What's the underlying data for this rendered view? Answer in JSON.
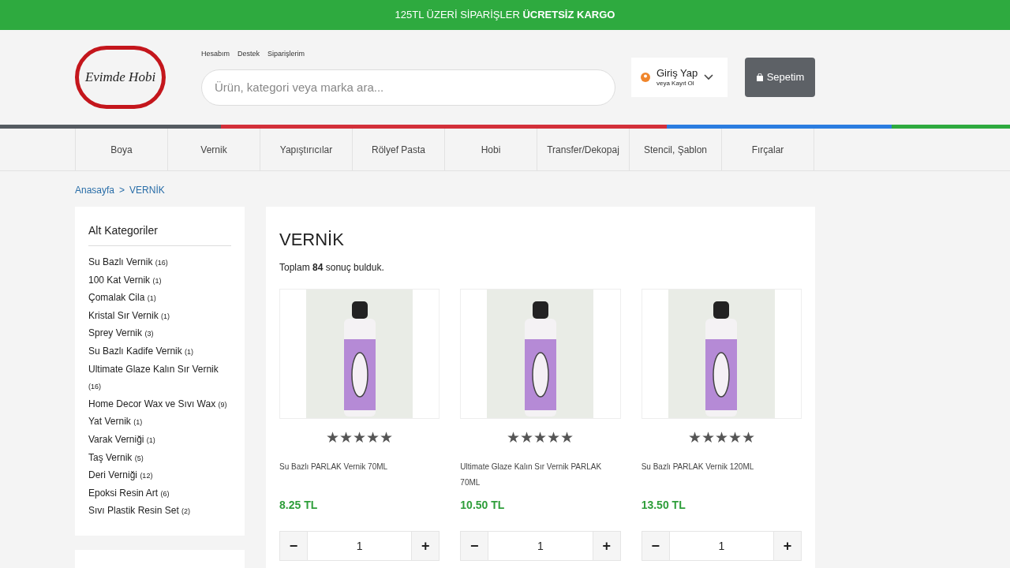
{
  "banner": {
    "text": "125TL ÜZERİ SİPARİŞLER **ÜCRETSİZ KARGO**"
  },
  "header": {
    "logo": "Evimde Hobi",
    "top_links": [
      "Hesabım",
      "Destek",
      "Siparişlerim"
    ],
    "search": {
      "placeholder": "Ürün, kategori veya marka ara..."
    },
    "login": {
      "title": "Giriş Yap",
      "subtitle": "veya Kayıt Ol"
    },
    "cart_button": "Sepetim"
  },
  "nav": [
    {
      "label": "Boya",
      "selected": false
    },
    {
      "label": "Vernik",
      "selected": false
    },
    {
      "label": "Yapıştırıcılar",
      "selected": false
    },
    {
      "label": "Rölyef Pasta",
      "selected": false
    },
    {
      "label": "Hobi",
      "selected": false
    },
    {
      "label": "Transfer/Dekopaj",
      "selected": false
    },
    {
      "label": "Stencil, Şablon",
      "selected": false
    },
    {
      "label": "Fırçalar",
      "selected": false
    }
  ],
  "breadcrumb": [
    "Anasayfa",
    ">",
    "VERNİK"
  ],
  "sidebar": {
    "title": "Alt Kategoriler",
    "items": [
      {
        "name": "Su Bazlı Vernik",
        "count": "(16)"
      },
      {
        "name": "100 Kat Vernik",
        "count": "(1)"
      },
      {
        "name": "Çomalak Cila",
        "count": "(1)"
      },
      {
        "name": "Kristal Sır Vernik",
        "count": "(1)"
      },
      {
        "name": "Sprey Vernik",
        "count": "(3)"
      },
      {
        "name": "Su Bazlı Kadife Vernik",
        "count": "(1)"
      },
      {
        "name": "Ultimate Glaze Kalın Sır Vernik",
        "count": "(16)"
      },
      {
        "name": "Home Decor Wax ve Sıvı Wax",
        "count": "(9)"
      },
      {
        "name": "Yat Vernik",
        "count": "(1)"
      },
      {
        "name": "Varak Verniği",
        "count": "(1)"
      },
      {
        "name": "Taş Vernik",
        "count": "(5)"
      },
      {
        "name": "Deri Verniği",
        "count": "(12)"
      },
      {
        "name": "Epoksi Resin Art",
        "count": "(6)"
      },
      {
        "name": "Sıvı Plastik Resin Set",
        "count": "(2)"
      }
    ]
  },
  "main": {
    "title": "VERNİK",
    "summary": "Toplam **84** sonuç bulduk.",
    "products": [
      {
        "name": "Su Bazlı PARLAK Vernik 70ML",
        "price": "8.25 TL",
        "stars": 5,
        "quantity": "1"
      },
      {
        "name": "Ultimate Glaze Kalın Sır Vernik PARLAK 70ML",
        "price": "10.50 TL",
        "stars": 5,
        "quantity": "1"
      },
      {
        "name": "Su Bazlı PARLAK Vernik 120ML",
        "price": "13.50 TL",
        "stars": 5,
        "quantity": "1"
      }
    ],
    "minus": "−",
    "plus": "+"
  }
}
